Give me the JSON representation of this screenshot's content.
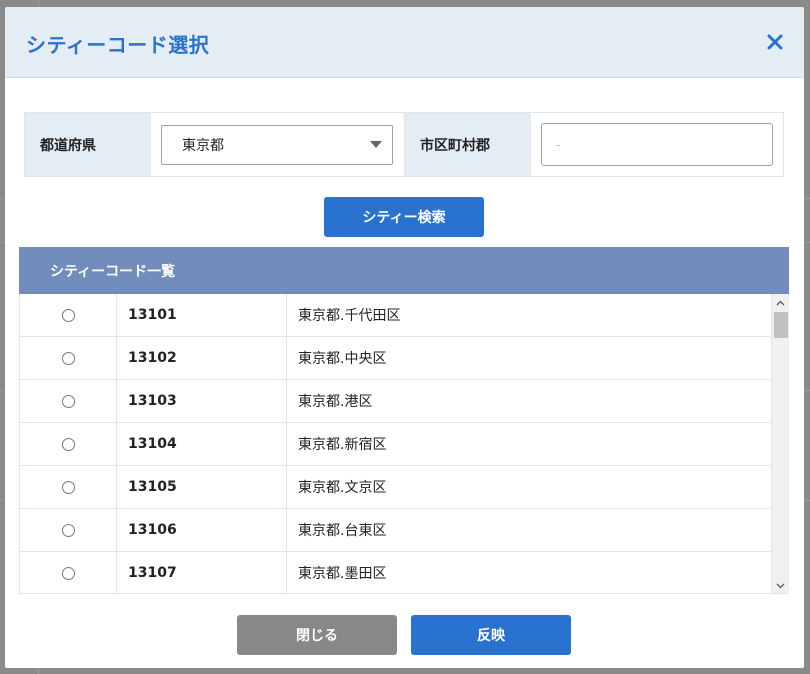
{
  "modal": {
    "title": "シティーコード選択"
  },
  "filter": {
    "prefecture_label": "都道府県",
    "prefecture_value": "東京都",
    "city_label": "市区町村郡",
    "city_value": "",
    "city_placeholder": "-"
  },
  "search": {
    "button_label": "シティー検索"
  },
  "list": {
    "header": "シティーコード一覧",
    "rows": [
      {
        "code": "13101",
        "name": "東京都.千代田区"
      },
      {
        "code": "13102",
        "name": "東京都.中央区"
      },
      {
        "code": "13103",
        "name": "東京都.港区"
      },
      {
        "code": "13104",
        "name": "東京都.新宿区"
      },
      {
        "code": "13105",
        "name": "東京都.文京区"
      },
      {
        "code": "13106",
        "name": "東京都.台東区"
      },
      {
        "code": "13107",
        "name": "東京都.墨田区"
      }
    ]
  },
  "footer": {
    "close_label": "閉じる",
    "apply_label": "反映"
  },
  "icons": {
    "close": "close-icon",
    "dropdown": "chevron-down-icon",
    "scroll_up": "chevron-up-icon",
    "scroll_down": "chevron-down-icon"
  },
  "colors": {
    "accent": "#2a72cf",
    "header_bg": "#e4ecf4",
    "list_header_bg": "#728cbc",
    "secondary_button": "#888888"
  }
}
